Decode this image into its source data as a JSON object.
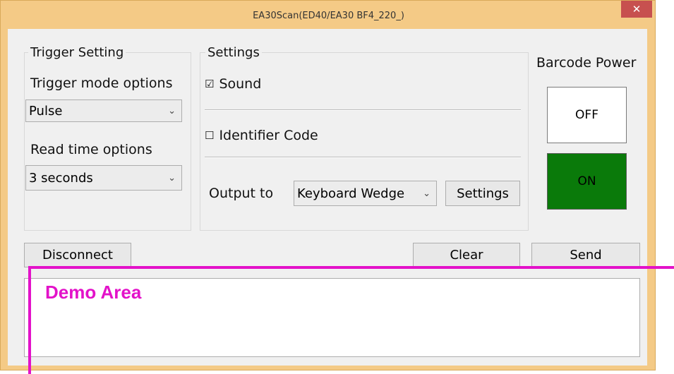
{
  "window": {
    "title": "EA30Scan(ED40/EA30 BF4_220_)",
    "close_glyph": "✕"
  },
  "trigger_group": {
    "legend": "Trigger Setting",
    "mode_label": "Trigger mode options",
    "mode_value": "Pulse",
    "read_time_label": "Read time options",
    "read_time_value": "3 seconds"
  },
  "settings_group": {
    "legend": "Settings",
    "sound_label": "Sound",
    "sound_checked": "☑",
    "identifier_label": "Identifier Code",
    "identifier_checked": "☐",
    "output_label": "Output to",
    "output_value": "Keyboard Wedge",
    "settings_button": "Settings"
  },
  "barcode_power": {
    "label": "Barcode Power",
    "off_label": "OFF",
    "on_label": "ON",
    "on_color": "#0a7a0a"
  },
  "buttons": {
    "disconnect": "Disconnect",
    "clear": "Clear",
    "send": "Send"
  },
  "annotation": {
    "text": "Demo Area",
    "color": "#e312c9"
  },
  "icons": {
    "dropdown": "chevron-down-icon"
  }
}
